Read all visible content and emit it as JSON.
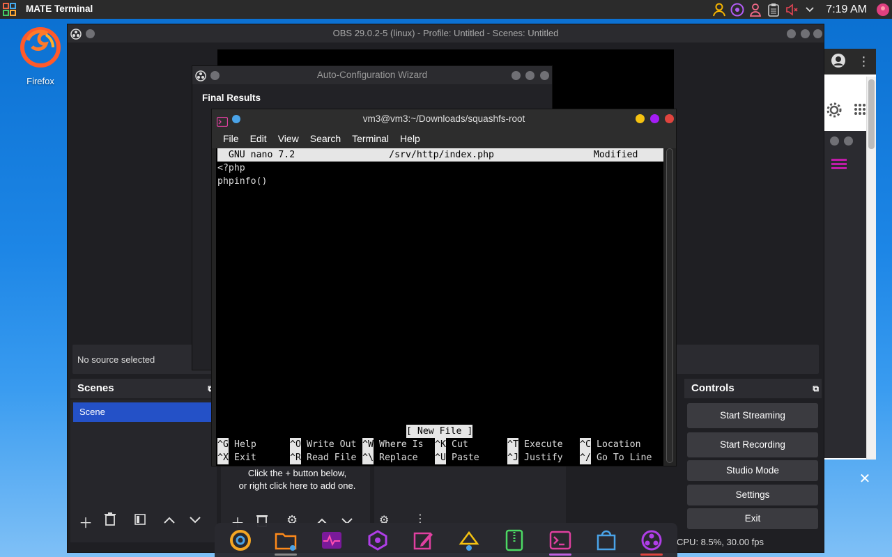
{
  "top_panel": {
    "active_window_title": "MATE Terminal",
    "clock": "7:19 AM",
    "tray_icons": [
      "user-icon",
      "obs-tray-icon",
      "account-icon",
      "clipboard-icon",
      "volume-muted-icon",
      "chevron-down-icon",
      "avatar-icon"
    ]
  },
  "desktop": {
    "icons": [
      {
        "label": "Firefox",
        "icon": "firefox-icon"
      }
    ]
  },
  "obs": {
    "title": "OBS 29.0.2-5 (linux) - Profile: Untitled - Scenes: Untitled",
    "no_source": "No source selected",
    "scenes_title": "Scenes",
    "scene_item": "Scene",
    "sources_hint_1": "Click the + button below,",
    "sources_hint_2": "or right click here to add one.",
    "controls_title": "Controls",
    "controls": [
      "Start Streaming",
      "Start Recording",
      "Studio Mode",
      "Settings",
      "Exit"
    ],
    "status": "CPU: 8.5%, 30.00 fps"
  },
  "wizard": {
    "title": "Auto-Configuration Wizard",
    "heading": "Final Results"
  },
  "terminal": {
    "title": "vm3@vm3:~/Downloads/squashfs-root",
    "menu": [
      "File",
      "Edit",
      "View",
      "Search",
      "Terminal",
      "Help"
    ],
    "nano_header": "  GNU nano 7.2                 /srv/http/index.php                  Modified  ",
    "lines": [
      "<?php",
      "phpinfo()"
    ],
    "status": "[ New File ]",
    "shortcuts_row1": [
      {
        "key": "^G",
        "label": "Help"
      },
      {
        "key": "^O",
        "label": "Write Out"
      },
      {
        "key": "^W",
        "label": "Where Is"
      },
      {
        "key": "^K",
        "label": "Cut"
      },
      {
        "key": "^T",
        "label": "Execute"
      },
      {
        "key": "^C",
        "label": "Location"
      }
    ],
    "shortcuts_row2": [
      {
        "key": "^X",
        "label": "Exit"
      },
      {
        "key": "^R",
        "label": "Read File"
      },
      {
        "key": "^\\",
        "label": "Replace"
      },
      {
        "key": "^U",
        "label": "Paste"
      },
      {
        "key": "^J",
        "label": "Justify"
      },
      {
        "key": "^/",
        "label": "Go To Line"
      }
    ]
  },
  "dock": {
    "apps": [
      "chrome-icon",
      "files-icon",
      "monitor-icon",
      "settings-app-icon",
      "text-editor-icon",
      "installer-icon",
      "archive-icon",
      "terminal-icon",
      "store-icon",
      "obs-icon"
    ]
  },
  "colors": {
    "accent_blue": "#2451c7",
    "terminal_close": "#e0443e",
    "terminal_min": "#f5c211",
    "terminal_max": "#a51df5"
  }
}
